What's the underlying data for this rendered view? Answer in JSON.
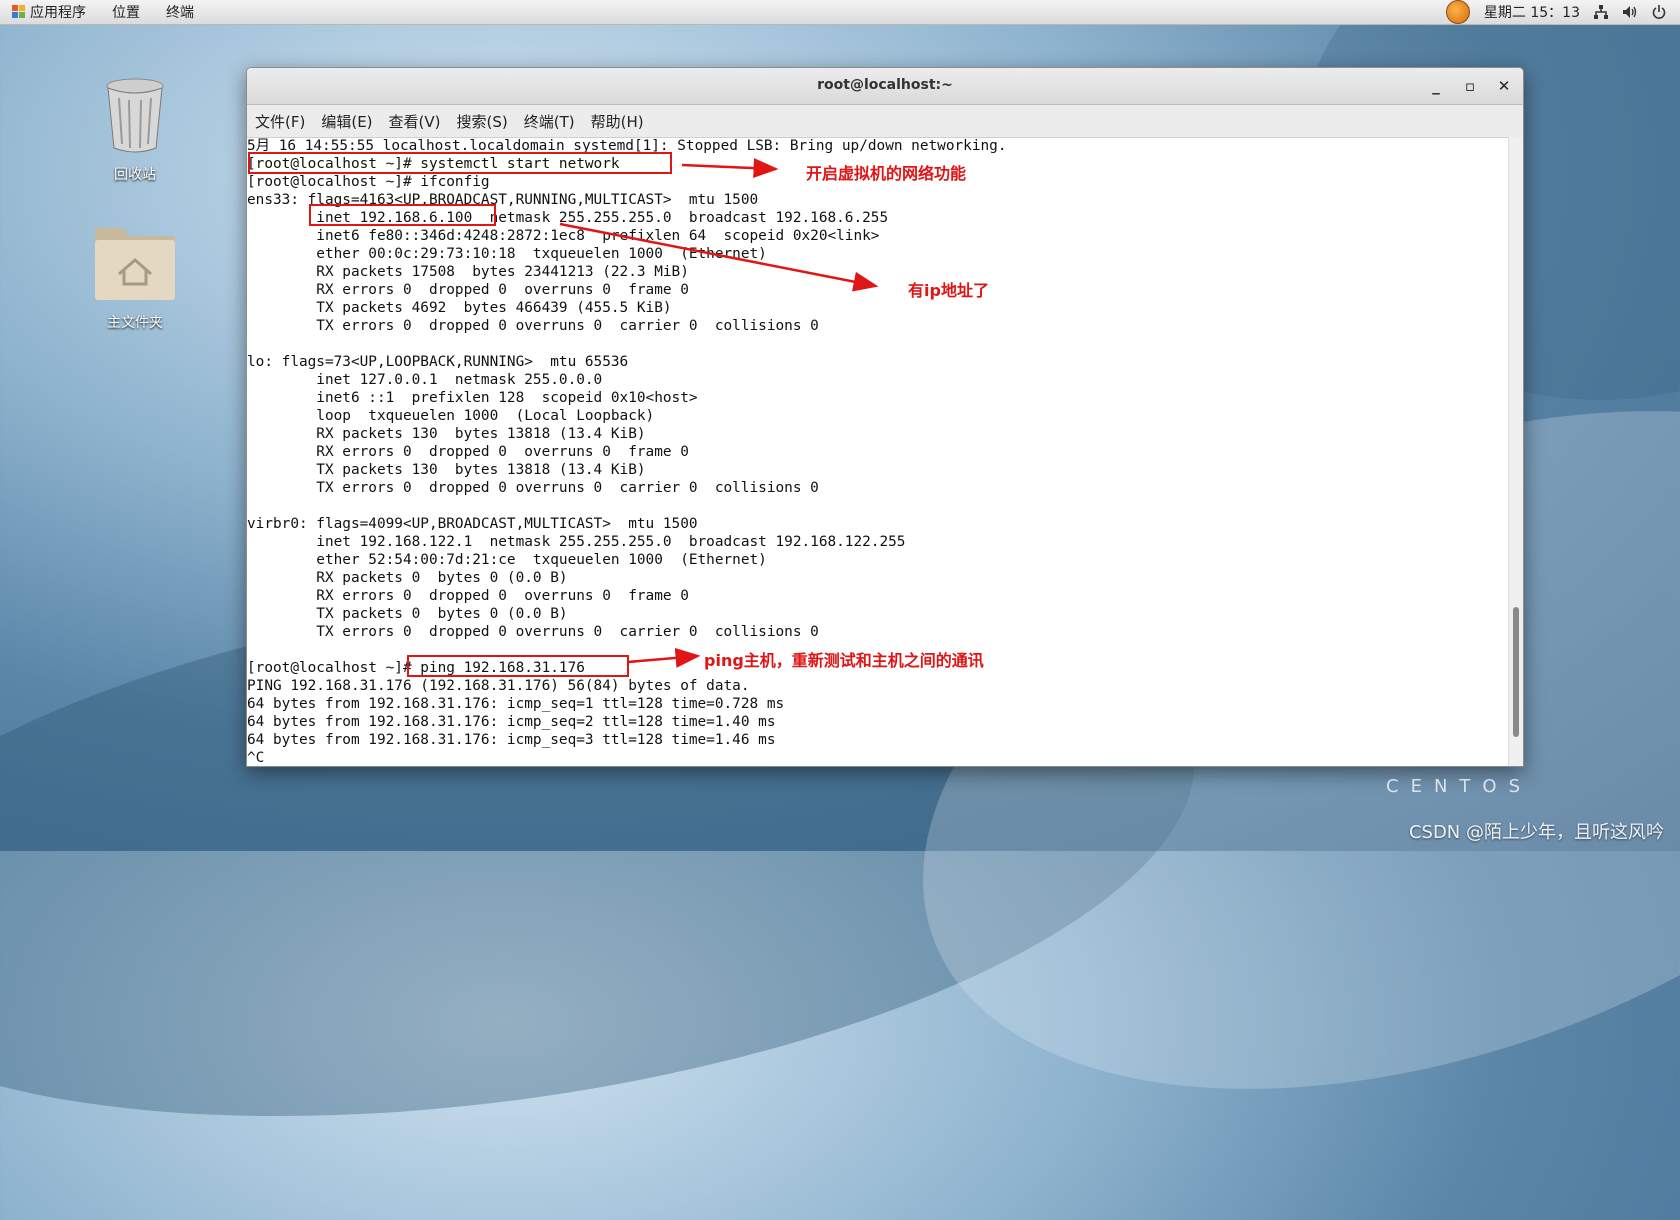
{
  "topbar": {
    "apps_label": "应用程序",
    "places_label": "位置",
    "terminal_label": "终端",
    "clock": "星期二 15：13"
  },
  "desktop": {
    "trash_label": "回收站",
    "home_label": "主文件夹"
  },
  "window": {
    "title": "root@localhost:~",
    "menu": [
      "文件(F)",
      "编辑(E)",
      "查看(V)",
      "搜索(S)",
      "终端(T)",
      "帮助(H)"
    ]
  },
  "terminal_lines": [
    "5月 16 14:55:55 localhost.localdomain systemd[1]: Stopped LSB: Bring up/down networking.",
    "[root@localhost ~]# systemctl start network",
    "[root@localhost ~]# ifconfig",
    "ens33: flags=4163<UP,BROADCAST,RUNNING,MULTICAST>  mtu 1500",
    "        inet 192.168.6.100  netmask 255.255.255.0  broadcast 192.168.6.255",
    "        inet6 fe80::346d:4248:2872:1ec8  prefixlen 64  scopeid 0x20<link>",
    "        ether 00:0c:29:73:10:18  txqueuelen 1000  (Ethernet)",
    "        RX packets 17508  bytes 23441213 (22.3 MiB)",
    "        RX errors 0  dropped 0  overruns 0  frame 0",
    "        TX packets 4692  bytes 466439 (455.5 KiB)",
    "        TX errors 0  dropped 0 overruns 0  carrier 0  collisions 0",
    "",
    "lo: flags=73<UP,LOOPBACK,RUNNING>  mtu 65536",
    "        inet 127.0.0.1  netmask 255.0.0.0",
    "        inet6 ::1  prefixlen 128  scopeid 0x10<host>",
    "        loop  txqueuelen 1000  (Local Loopback)",
    "        RX packets 130  bytes 13818 (13.4 KiB)",
    "        RX errors 0  dropped 0  overruns 0  frame 0",
    "        TX packets 130  bytes 13818 (13.4 KiB)",
    "        TX errors 0  dropped 0 overruns 0  carrier 0  collisions 0",
    "",
    "virbr0: flags=4099<UP,BROADCAST,MULTICAST>  mtu 1500",
    "        inet 192.168.122.1  netmask 255.255.255.0  broadcast 192.168.122.255",
    "        ether 52:54:00:7d:21:ce  txqueuelen 1000  (Ethernet)",
    "        RX packets 0  bytes 0 (0.0 B)",
    "        RX errors 0  dropped 0  overruns 0  frame 0",
    "        TX packets 0  bytes 0 (0.0 B)",
    "        TX errors 0  dropped 0 overruns 0  carrier 0  collisions 0",
    "",
    "[root@localhost ~]# ping 192.168.31.176",
    "PING 192.168.31.176 (192.168.31.176) 56(84) bytes of data.",
    "64 bytes from 192.168.31.176: icmp_seq=1 ttl=128 time=0.728 ms",
    "64 bytes from 192.168.31.176: icmp_seq=2 ttl=128 time=1.40 ms",
    "64 bytes from 192.168.31.176: icmp_seq=3 ttl=128 time=1.46 ms",
    "^C"
  ],
  "annotations": {
    "network_start": "开启虚拟机的网络功能",
    "has_ip": "有ip地址了",
    "ping_host": "ping主机，重新测试和主机之间的通讯",
    "color": "#e01515"
  },
  "branding": {
    "os": "CENTOS",
    "watermark": "CSDN @陌上少年，且听这风吟"
  }
}
